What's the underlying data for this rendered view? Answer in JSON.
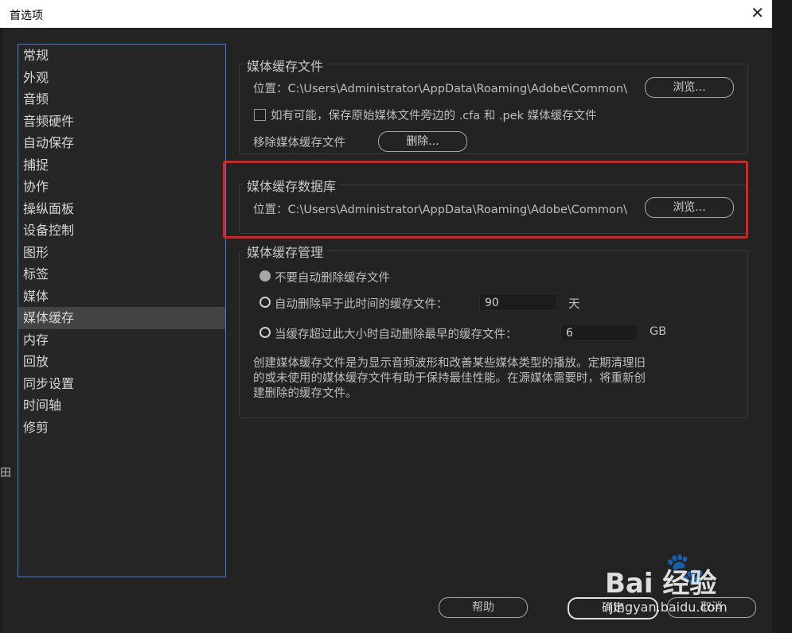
{
  "window": {
    "title": "首选项",
    "close_glyph": "✕"
  },
  "sidebar": {
    "items": [
      {
        "label": "常规"
      },
      {
        "label": "外观"
      },
      {
        "label": "音频"
      },
      {
        "label": "音频硬件"
      },
      {
        "label": "自动保存"
      },
      {
        "label": "捕捉"
      },
      {
        "label": "协作"
      },
      {
        "label": "操纵面板"
      },
      {
        "label": "设备控制"
      },
      {
        "label": "图形"
      },
      {
        "label": "标签"
      },
      {
        "label": "媒体"
      },
      {
        "label": "媒体缓存",
        "active": true
      },
      {
        "label": "内存"
      },
      {
        "label": "回放"
      },
      {
        "label": "同步设置"
      },
      {
        "label": "时间轴"
      },
      {
        "label": "修剪"
      }
    ]
  },
  "media_cache_files": {
    "title": "媒体缓存文件",
    "location_label": "位置：C:\\Users\\Administrator\\AppData\\Roaming\\Adobe\\Common\\",
    "browse_label": "浏览...",
    "checkbox_label": "如有可能，保存原始媒体文件旁边的 .cfa 和 .pek 媒体缓存文件",
    "remove_label": "移除媒体缓存文件",
    "delete_label": "删除..."
  },
  "media_cache_db": {
    "title": "媒体缓存数据库",
    "location_label": "位置：C:\\Users\\Administrator\\AppData\\Roaming\\Adobe\\Common\\",
    "browse_label": "浏览..."
  },
  "media_cache_mgmt": {
    "title": "媒体缓存管理",
    "option1": "不要自动删除缓存文件",
    "option2": "自动删除早于此时间的缓存文件：",
    "option2_value": "90",
    "option2_unit": "天",
    "option3": "当缓存超过此大小时自动删除最早的缓存文件：",
    "option3_value": "6",
    "option3_unit": "GB",
    "description": "创建媒体缓存文件是为显示音频波形和改善某些媒体类型的播放。定期清理旧的或未使用的媒体缓存文件有助于保持最佳性能。在源媒体需要时，将重新创建删除的缓存文件。"
  },
  "footer": {
    "help": "帮助",
    "ok": "确定",
    "cancel": "取消"
  },
  "watermark": {
    "logo": "Bai  经验",
    "sub": "jingyan.baidu.com"
  },
  "edge_glyph": "田",
  "colors": {
    "highlight": "#e02020",
    "sidebar_border": "#3e7ad6",
    "background": "#232323"
  }
}
